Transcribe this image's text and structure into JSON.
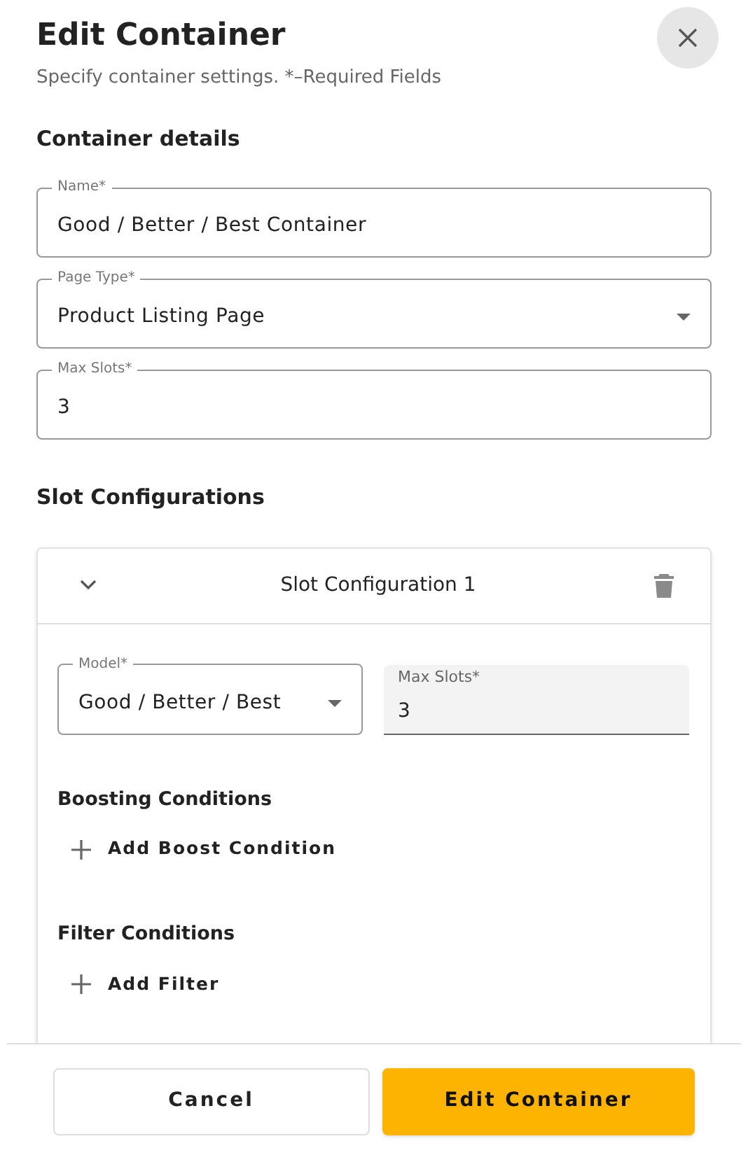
{
  "dialog": {
    "title": "Edit Container",
    "subtitle": "Specify container settings. *–Required Fields"
  },
  "container_details": {
    "heading": "Container details",
    "fields": [
      {
        "kind": "text",
        "label": "Name*",
        "value": "Good / Better / Best Container"
      },
      {
        "kind": "select",
        "label": "Page Type*",
        "value": "Product Listing Page"
      },
      {
        "kind": "text",
        "label": "Max Slots*",
        "value": "3"
      }
    ]
  },
  "slot_configurations": {
    "heading": "Slot Configurations",
    "items": [
      {
        "title": "Slot Configuration 1",
        "expanded": true,
        "fields": [
          {
            "kind": "select",
            "label": "Model*",
            "value": "Good / Better / Best"
          },
          {
            "kind": "filled",
            "label": "Max Slots*",
            "value": "3"
          }
        ],
        "groups": [
          {
            "heading": "Boosting Conditions",
            "action": "Add Boost Condition"
          },
          {
            "heading": "Filter Conditions",
            "action": "Add Filter"
          }
        ]
      }
    ]
  },
  "buttons": [
    {
      "kind": "secondary",
      "label": "Cancel"
    },
    {
      "kind": "primary",
      "label": "Edit Container"
    }
  ]
}
